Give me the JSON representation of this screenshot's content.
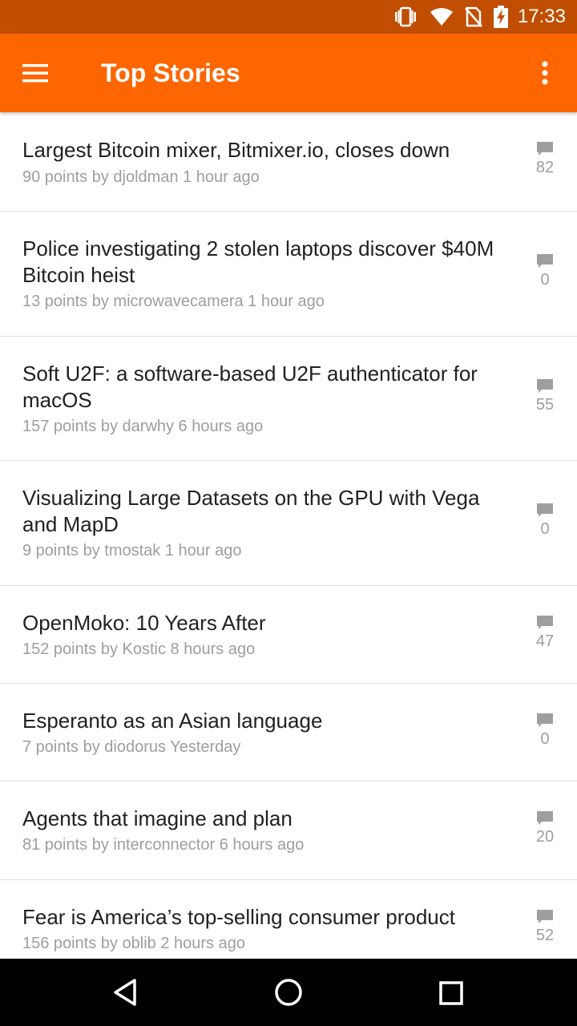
{
  "status_bar": {
    "time": "17:33",
    "icons": [
      "vibrate-icon",
      "wifi-icon",
      "no-sim-icon",
      "battery-charging-icon"
    ]
  },
  "app_bar": {
    "title": "Top Stories",
    "menu_icon": "hamburger-menu-icon",
    "overflow_icon": "more-vert-icon"
  },
  "colors": {
    "status_bar": "#c14e00",
    "app_bar": "#ff6600",
    "title_text": "#212121",
    "meta_text": "#9e9e9e",
    "divider": "#e2e2e2"
  },
  "stories": [
    {
      "title": "Largest Bitcoin mixer, Bitmixer.io, closes down",
      "meta": "90 points by djoldman 1 hour ago",
      "comments": "82"
    },
    {
      "title": "Police investigating 2 stolen laptops discover $40M Bitcoin heist",
      "meta": "13 points by microwavecamera 1 hour ago",
      "comments": "0"
    },
    {
      "title": "Soft U2F: a software-based U2F authenticator for macOS",
      "meta": "157 points by darwhy 6 hours ago",
      "comments": "55"
    },
    {
      "title": "Visualizing Large Datasets on the GPU with Vega and MapD",
      "meta": "9 points by tmostak 1 hour ago",
      "comments": "0"
    },
    {
      "title": "OpenMoko: 10 Years After",
      "meta": "152 points by Kostic 8 hours ago",
      "comments": "47"
    },
    {
      "title": "Esperanto as an Asian language",
      "meta": "7 points by diodorus Yesterday",
      "comments": "0"
    },
    {
      "title": "Agents that imagine and plan",
      "meta": "81 points by interconnector 6 hours ago",
      "comments": "20"
    },
    {
      "title": "Fear is America’s top-selling consumer product",
      "meta": "156 points by oblib 2 hours ago",
      "comments": "52"
    }
  ],
  "nav_bar": {
    "buttons": [
      "back-icon",
      "home-icon",
      "recents-icon"
    ]
  }
}
